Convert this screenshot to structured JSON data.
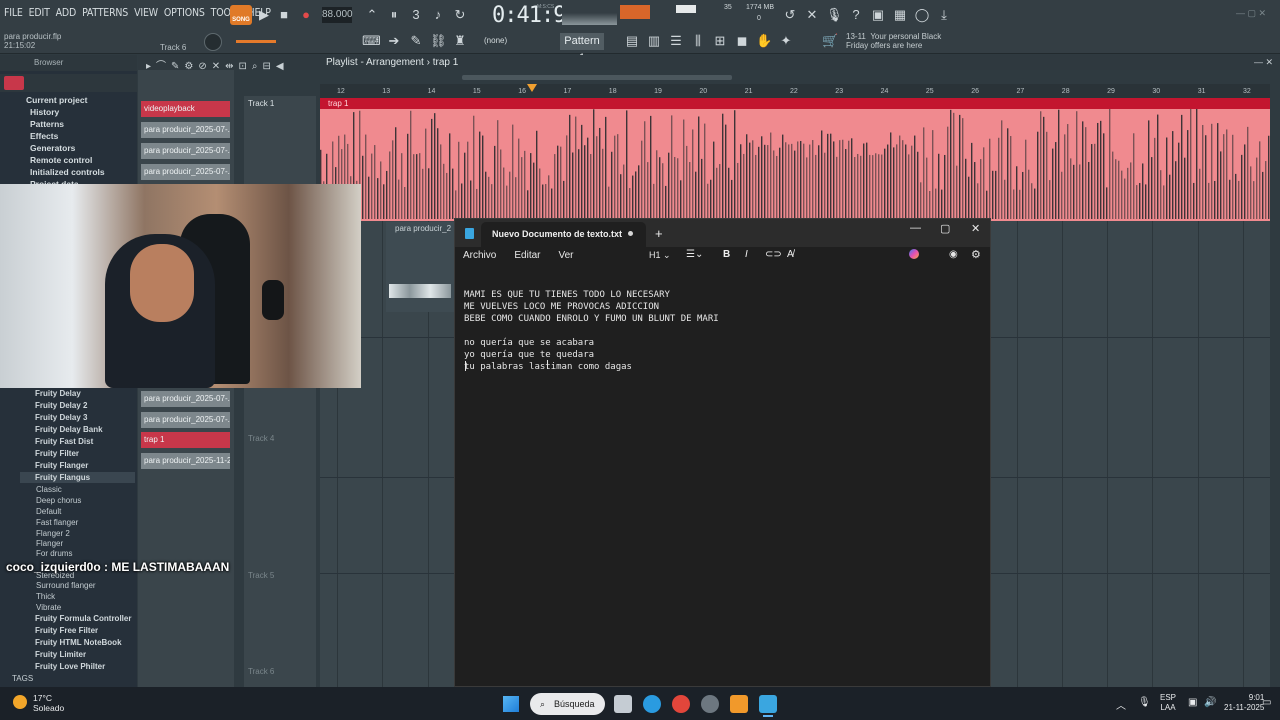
{
  "fl": {
    "menu": [
      "FILE",
      "EDIT",
      "ADD",
      "PATTERNS",
      "VIEW",
      "OPTIONS",
      "TOOLS",
      "HELP"
    ],
    "song_badge": "SONG",
    "tempo": "88.000",
    "time": "0:41:99",
    "time_sub": "M:S:CS",
    "memory": "1774 MB",
    "cpu": "35",
    "cpu2": "0",
    "file_name": "para producir.flp",
    "file_time": "21:15:02",
    "track_hint": "Track 6",
    "none_select": "(none)",
    "pattern": "Pattern 1",
    "promo_date": "13-11",
    "promo_line1": "Your personal Black",
    "promo_line2": "Friday offers are here"
  },
  "browser": {
    "header": "Browser",
    "items": [
      "Current project",
      "History",
      "Patterns",
      "Effects",
      "Generators",
      "Remote control",
      "Initialized controls",
      "Project data"
    ],
    "fruity": [
      "Fruity Delay",
      "Fruity Delay 2",
      "Fruity Delay 3",
      "Fruity Delay Bank",
      "Fruity Fast Dist",
      "Fruity Filter",
      "Fruity Flanger",
      "Fruity Flangus"
    ],
    "presets": [
      "Classic",
      "Deep chorus",
      "Default",
      "Fast flanger",
      "Flanger 2",
      "Flanger",
      "For drums",
      "Stereoized",
      "Surround flanger",
      "Thick",
      "Vibrate"
    ],
    "fruity2": [
      "Fruity Formula Controller",
      "Fruity Free Filter",
      "Fruity HTML NoteBook",
      "Fruity Limiter",
      "Fruity Love Philter"
    ],
    "tags": "TAGS"
  },
  "picker": {
    "top": [
      "videoplayback",
      "para producir_2025-07-...",
      "para producir_2025-07-...",
      "para producir_2025-07-..."
    ],
    "bottom": [
      "para producir_2025-07-...",
      "para producir_2025-07-...",
      "trap 1",
      "para producir_2025-11-2..."
    ]
  },
  "playlist": {
    "title": "Playlist - Arrangement",
    "pattern_crumb": "trap 1",
    "track1": "Track 1",
    "track4": "Track 4",
    "track5": "Track 5",
    "track6": "Track 6",
    "clip_label": "trap 1",
    "clip2_label": "para producir_2",
    "ruler": [
      "12",
      "13",
      "14",
      "15",
      "16",
      "17",
      "18",
      "19",
      "20",
      "21",
      "22",
      "23",
      "24",
      "25",
      "26",
      "27",
      "28",
      "29",
      "30",
      "31",
      "32"
    ]
  },
  "notepad": {
    "tab_title": "Nuevo Documento de texto.txt",
    "menu": [
      "Archivo",
      "Editar",
      "Ver"
    ],
    "heading": "H1",
    "lines": [
      "MAMI ES QUE TU TIENES TODO LO NECESARY",
      "ME VUELVES LOCO ME PROVOCAS ADICCION",
      "BEBE COMO CUANDO ENROLO Y FUMO UN BLUNT DE MARI",
      "",
      "no quería que se acabara",
      "yo quería que te quedara",
      "tu palabras lastiman como dagas"
    ]
  },
  "chat": {
    "user": "coco_izquierd0o",
    "message": ": ME LASTIMABAAAN"
  },
  "taskbar": {
    "temp": "17°C",
    "weather": "Soleado",
    "search": "Búsqueda",
    "lang1": "ESP",
    "lang2": "LAA",
    "time": "9:01",
    "date": "21-11-2025"
  }
}
